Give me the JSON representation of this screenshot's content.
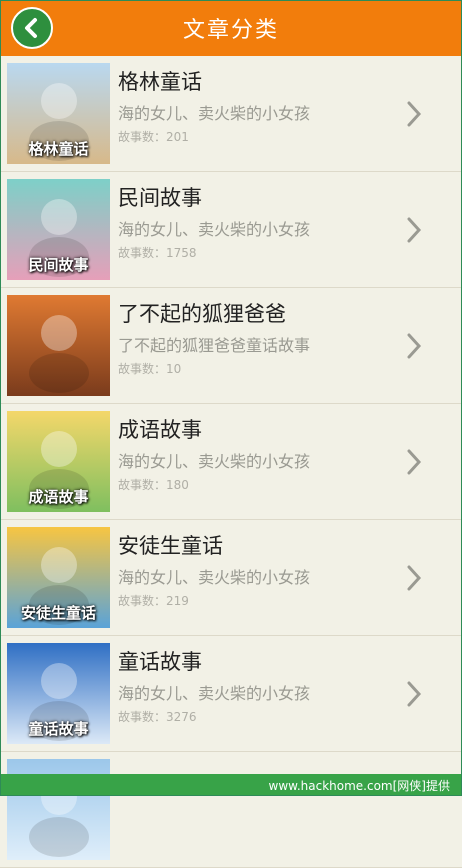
{
  "header": {
    "title": "文章分类",
    "back_icon": "back-arrow-icon"
  },
  "colors": {
    "header_bg": "#f27d0c",
    "back_bg": "#2e8f3e",
    "footer_bg": "#38a348"
  },
  "categories": [
    {
      "title": "格林童话",
      "subtitle": "海的女儿、卖火柴的小女孩",
      "count": "故事数：201",
      "thumb_label": "格林童话",
      "thumb_colors": [
        "#b9d8f0",
        "#d7b98a"
      ]
    },
    {
      "title": "民间故事",
      "subtitle": "海的女儿、卖火柴的小女孩",
      "count": "故事数：1758",
      "thumb_label": "民间故事",
      "thumb_colors": [
        "#7dd0c8",
        "#e69fb9"
      ]
    },
    {
      "title": "了不起的狐狸爸爸",
      "subtitle": "了不起的狐狸爸爸童话故事",
      "count": "故事数：10",
      "thumb_label": "",
      "thumb_colors": [
        "#e07a32",
        "#7a3b1c"
      ]
    },
    {
      "title": "成语故事",
      "subtitle": "海的女儿、卖火柴的小女孩",
      "count": "故事数：180",
      "thumb_label": "成语故事",
      "thumb_colors": [
        "#f4d76a",
        "#7fbf5f"
      ]
    },
    {
      "title": "安徒生童话",
      "subtitle": "海的女儿、卖火柴的小女孩",
      "count": "故事数：219",
      "thumb_label": "安徒生童话",
      "thumb_colors": [
        "#f7c542",
        "#5aa3d8"
      ]
    },
    {
      "title": "童话故事",
      "subtitle": "海的女儿、卖火柴的小女孩",
      "count": "故事数：3276",
      "thumb_label": "童话故事",
      "thumb_colors": [
        "#2f6fc4",
        "#dce9f7"
      ]
    },
    {
      "title": "",
      "subtitle": "",
      "count": "",
      "thumb_label": "",
      "thumb_colors": [
        "#9cc7ea",
        "#dfeefa"
      ]
    }
  ],
  "footer": {
    "text": "www.hackhome.com[网侠]提供"
  }
}
